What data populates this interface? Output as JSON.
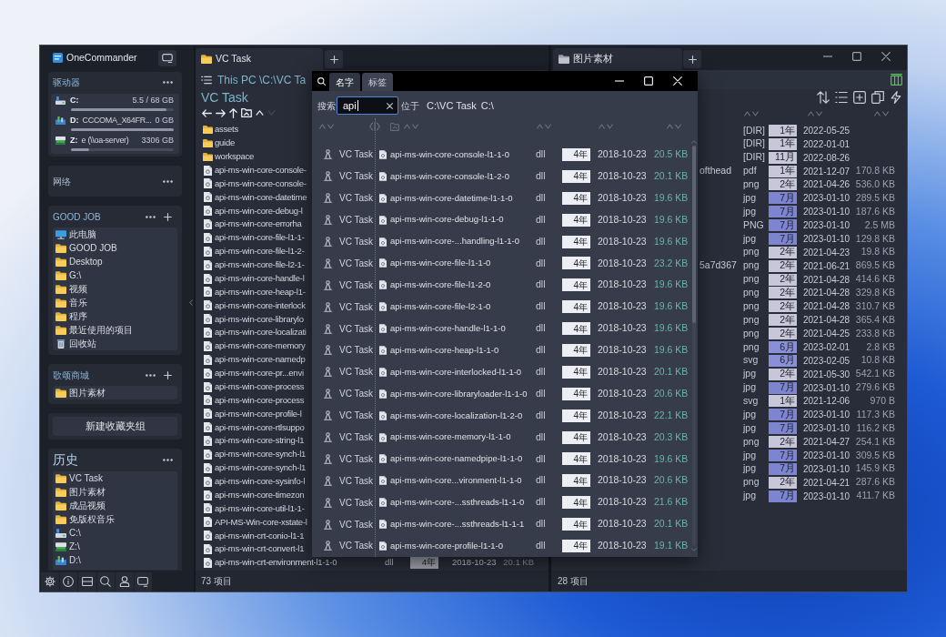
{
  "sidebar": {
    "app_name": "OneCommander",
    "drives": {
      "title": "驱动器",
      "items": [
        {
          "kind": "disk",
          "letter": "C:",
          "free": "5.5 / 68 GB",
          "level": 0.93
        },
        {
          "kind": "removable",
          "letter": "D:",
          "label": "CCCOMA_X64FR...",
          "free": "0 GB",
          "level": 1
        },
        {
          "kind": "network",
          "letter": "Z:",
          "label": "e (\\\\oa-server)",
          "free": "3306 GB",
          "level": 0.18
        }
      ]
    },
    "network": {
      "title": "网络"
    },
    "groups": [
      {
        "title": "GOOD JOB",
        "items": [
          {
            "kind": "computer",
            "name": "此电脑"
          },
          {
            "kind": "folder",
            "name": "GOOD JOB"
          },
          {
            "kind": "folder",
            "name": "Desktop"
          },
          {
            "kind": "folder",
            "name": "G:\\"
          },
          {
            "kind": "folder",
            "name": "视频"
          },
          {
            "kind": "folder",
            "name": "音乐"
          },
          {
            "kind": "folder",
            "name": "程序"
          },
          {
            "kind": "folder",
            "name": "最近使用的项目"
          },
          {
            "kind": "trash",
            "name": "回收站"
          }
        ]
      },
      {
        "title": "歌颂商城",
        "items": [
          {
            "kind": "folder",
            "name": "图片素材"
          }
        ]
      }
    ],
    "new_group_button": "新建收藏夹组",
    "history": {
      "title": "历史",
      "items": [
        {
          "kind": "folder",
          "name": "VC Task"
        },
        {
          "kind": "folder",
          "name": "图片素材"
        },
        {
          "kind": "folder",
          "name": "成品视频"
        },
        {
          "kind": "folder",
          "name": "免版权音乐"
        },
        {
          "kind": "disk",
          "name": "C:\\"
        },
        {
          "kind": "network",
          "name": "Z:\\"
        },
        {
          "kind": "removable",
          "name": "D:\\"
        }
      ]
    }
  },
  "left_pane": {
    "tab": "VC Task",
    "path": "This PC \\C:\\VC Ta",
    "title": "VC Task",
    "nav": [
      {
        "kind": "back",
        "disabled": false
      },
      {
        "kind": "forward",
        "disabled": false
      },
      {
        "kind": "up",
        "disabled": false
      },
      {
        "kind": "parent",
        "disabled": false
      },
      {
        "kind": "chevronup",
        "disabled": false
      },
      {
        "kind": "chevrondown",
        "disabled": true
      }
    ],
    "files": [
      {
        "kind": "folder",
        "name": "assets"
      },
      {
        "kind": "folder",
        "name": "guide"
      },
      {
        "kind": "folder",
        "name": "workspace"
      },
      {
        "kind": "file",
        "name": "api-ms-win-core-console-"
      },
      {
        "kind": "file",
        "name": "api-ms-win-core-console-"
      },
      {
        "kind": "file",
        "name": "api-ms-win-core-datetime"
      },
      {
        "kind": "file",
        "name": "api-ms-win-core-debug-l"
      },
      {
        "kind": "file",
        "name": "api-ms-win-core-errorha"
      },
      {
        "kind": "file",
        "name": "api-ms-win-core-file-l1-1-"
      },
      {
        "kind": "file",
        "name": "api-ms-win-core-file-l1-2-"
      },
      {
        "kind": "file",
        "name": "api-ms-win-core-file-l2-1-"
      },
      {
        "kind": "file",
        "name": "api-ms-win-core-handle-l"
      },
      {
        "kind": "file",
        "name": "api-ms-win-core-heap-l1-"
      },
      {
        "kind": "file",
        "name": "api-ms-win-core-interlock"
      },
      {
        "kind": "file",
        "name": "api-ms-win-core-librarylo"
      },
      {
        "kind": "file",
        "name": "api-ms-win-core-localizati"
      },
      {
        "kind": "file",
        "name": "api-ms-win-core-memory"
      },
      {
        "kind": "file",
        "name": "api-ms-win-core-namedp"
      },
      {
        "kind": "file",
        "name": "api-ms-win-core-pr...envi"
      },
      {
        "kind": "file",
        "name": "api-ms-win-core-process"
      },
      {
        "kind": "file",
        "name": "api-ms-win-core-process"
      },
      {
        "kind": "file",
        "name": "api-ms-win-core-profile-l"
      },
      {
        "kind": "file",
        "name": "api-ms-win-core-rtlsuppo"
      },
      {
        "kind": "file",
        "name": "api-ms-win-core-string-l1"
      },
      {
        "kind": "file",
        "name": "api-ms-win-core-synch-l1"
      },
      {
        "kind": "file",
        "name": "api-ms-win-core-synch-l1"
      },
      {
        "kind": "file",
        "name": "api-ms-win-core-sysinfo-l"
      },
      {
        "kind": "file",
        "name": "api-ms-win-core-timezon"
      },
      {
        "kind": "file",
        "name": "api-ms-win-core-util-l1-1-"
      },
      {
        "kind": "file",
        "name": "API-MS-Win-core-xstate-l"
      },
      {
        "kind": "file",
        "name": "api-ms-win-crt-conio-l1-1"
      },
      {
        "kind": "file",
        "name": "api-ms-win-crt-convert-l1"
      },
      {
        "kind": "file",
        "name": "api-ms-win-crt-environment-l1-1-0",
        "type": "dll",
        "age": "4年",
        "date": "2018-10-23",
        "size": "20.1 KB"
      }
    ],
    "status": "73 项目"
  },
  "right_pane": {
    "tab": "图片素材",
    "files": [
      {
        "type": "[DIR]",
        "age": "1年",
        "color": "#c8c6d9",
        "date": "2022-05-25"
      },
      {
        "type": "[DIR]",
        "age": "1年",
        "color": "#c8c6d9",
        "date": "2022-01-01"
      },
      {
        "type": "[DIR]",
        "age": "11月",
        "color": "#c8c6d9",
        "date": "2022-08-26"
      },
      {
        "name": "ofthead",
        "type": "pdf",
        "age": "1年",
        "color": "#c8c6d9",
        "date": "2021-12-07",
        "size": "170.8 KB"
      },
      {
        "type": "png",
        "age": "2年",
        "color": "#c8c6d9",
        "date": "2021-04-26",
        "size": "536.0 KB"
      },
      {
        "type": "jpg",
        "age": "7月",
        "color": "#7d85d0",
        "date": "2023-01-10",
        "size": "289.5 KB"
      },
      {
        "type": "jpg",
        "age": "7月",
        "color": "#7d85d0",
        "date": "2023-01-10",
        "size": "187.6 KB"
      },
      {
        "type": "PNG",
        "age": "7月",
        "color": "#7d85d0",
        "date": "2023-01-10",
        "size": "2.5 MB"
      },
      {
        "type": "jpg",
        "age": "7月",
        "color": "#7d85d0",
        "date": "2023-01-10",
        "size": "129.8 KB"
      },
      {
        "type": "png",
        "age": "2年",
        "color": "#c8c6d9",
        "date": "2021-04-23",
        "size": "19.8 KB"
      },
      {
        "name": "5a7d367",
        "type": "png",
        "age": "2年",
        "color": "#c8c6d9",
        "date": "2021-06-21",
        "size": "869.5 KB"
      },
      {
        "type": "png",
        "age": "2年",
        "color": "#c8c6d9",
        "date": "2021-04-28",
        "size": "414.6 KB"
      },
      {
        "type": "png",
        "age": "2年",
        "color": "#c8c6d9",
        "date": "2021-04-28",
        "size": "329.8 KB"
      },
      {
        "type": "png",
        "age": "2年",
        "color": "#c8c6d9",
        "date": "2021-04-28",
        "size": "310.7 KB"
      },
      {
        "type": "png",
        "age": "2年",
        "color": "#c8c6d9",
        "date": "2021-04-28",
        "size": "365.4 KB"
      },
      {
        "type": "png",
        "age": "2年",
        "color": "#c8c6d9",
        "date": "2021-04-25",
        "size": "233.8 KB"
      },
      {
        "type": "png",
        "age": "6月",
        "color": "#8a90d8",
        "date": "2023-02-01",
        "size": "2.8 KB"
      },
      {
        "type": "svg",
        "age": "6月",
        "color": "#8a90d8",
        "date": "2023-02-05",
        "size": "10.8 KB"
      },
      {
        "type": "jpg",
        "age": "2年",
        "color": "#c8c6d9",
        "date": "2021-05-30",
        "size": "542.1 KB"
      },
      {
        "type": "jpg",
        "age": "7月",
        "color": "#7d85d0",
        "date": "2023-01-10",
        "size": "279.6 KB"
      },
      {
        "type": "svg",
        "age": "1年",
        "color": "#c8c6d9",
        "date": "2021-12-06",
        "size": "970 B"
      },
      {
        "type": "jpg",
        "age": "7月",
        "color": "#7d85d0",
        "date": "2023-01-10",
        "size": "117.3 KB"
      },
      {
        "type": "jpg",
        "age": "7月",
        "color": "#7d85d0",
        "date": "2023-01-10",
        "size": "116.2 KB"
      },
      {
        "type": "png",
        "age": "2年",
        "color": "#c8c6d9",
        "date": "2021-04-27",
        "size": "254.1 KB"
      },
      {
        "type": "jpg",
        "age": "7月",
        "color": "#7d85d0",
        "date": "2023-01-10",
        "size": "309.5 KB"
      },
      {
        "type": "jpg",
        "age": "7月",
        "color": "#7d85d0",
        "date": "2023-01-10",
        "size": "145.9 KB"
      },
      {
        "type": "png",
        "age": "2年",
        "color": "#c8c6d9",
        "date": "2021-04-21",
        "size": "287.6 KB"
      },
      {
        "type": "jpg",
        "age": "7月",
        "color": "#7d85d0",
        "date": "2023-01-10",
        "size": "411.7 KB"
      }
    ],
    "status": "28 项目"
  },
  "search_dialog": {
    "tabs": [
      {
        "label": "名字",
        "selected": true
      },
      {
        "label": "标签",
        "selected": false
      }
    ],
    "search_label": "搜索",
    "query": "api",
    "location_label": "位于",
    "locations": [
      "C:\\VC Task",
      "C:\\"
    ],
    "results": [
      {
        "location": "VC Task",
        "name": "api-ms-win-core-console-l1-1-0",
        "type": "dll",
        "age": "4年",
        "date": "2018-10-23",
        "size": "20.5 KB"
      },
      {
        "location": "VC Task",
        "name": "api-ms-win-core-console-l1-2-0",
        "type": "dll",
        "age": "4年",
        "date": "2018-10-23",
        "size": "20.1 KB"
      },
      {
        "location": "VC Task",
        "name": "api-ms-win-core-datetime-l1-1-0",
        "type": "dll",
        "age": "4年",
        "date": "2018-10-23",
        "size": "19.6 KB"
      },
      {
        "location": "VC Task",
        "name": "api-ms-win-core-debug-l1-1-0",
        "type": "dll",
        "age": "4年",
        "date": "2018-10-23",
        "size": "19.6 KB"
      },
      {
        "location": "VC Task",
        "name": "api-ms-win-core-...handling-l1-1-0",
        "type": "dll",
        "age": "4年",
        "date": "2018-10-23",
        "size": "19.6 KB"
      },
      {
        "location": "VC Task",
        "name": "api-ms-win-core-file-l1-1-0",
        "type": "dll",
        "age": "4年",
        "date": "2018-10-23",
        "size": "23.2 KB"
      },
      {
        "location": "VC Task",
        "name": "api-ms-win-core-file-l1-2-0",
        "type": "dll",
        "age": "4年",
        "date": "2018-10-23",
        "size": "19.6 KB"
      },
      {
        "location": "VC Task",
        "name": "api-ms-win-core-file-l2-1-0",
        "type": "dll",
        "age": "4年",
        "date": "2018-10-23",
        "size": "19.6 KB"
      },
      {
        "location": "VC Task",
        "name": "api-ms-win-core-handle-l1-1-0",
        "type": "dll",
        "age": "4年",
        "date": "2018-10-23",
        "size": "19.6 KB"
      },
      {
        "location": "VC Task",
        "name": "api-ms-win-core-heap-l1-1-0",
        "type": "dll",
        "age": "4年",
        "date": "2018-10-23",
        "size": "19.6 KB"
      },
      {
        "location": "VC Task",
        "name": "api-ms-win-core-interlocked-l1-1-0",
        "type": "dll",
        "age": "4年",
        "date": "2018-10-23",
        "size": "20.1 KB"
      },
      {
        "location": "VC Task",
        "name": "api-ms-win-core-libraryloader-l1-1-0",
        "type": "dll",
        "age": "4年",
        "date": "2018-10-23",
        "size": "20.6 KB"
      },
      {
        "location": "VC Task",
        "name": "api-ms-win-core-localization-l1-2-0",
        "type": "dll",
        "age": "4年",
        "date": "2018-10-23",
        "size": "22.1 KB"
      },
      {
        "location": "VC Task",
        "name": "api-ms-win-core-memory-l1-1-0",
        "type": "dll",
        "age": "4年",
        "date": "2018-10-23",
        "size": "20.3 KB"
      },
      {
        "location": "VC Task",
        "name": "api-ms-win-core-namedpipe-l1-1-0",
        "type": "dll",
        "age": "4年",
        "date": "2018-10-23",
        "size": "19.6 KB"
      },
      {
        "location": "VC Task",
        "name": "api-ms-win-core...vironment-l1-1-0",
        "type": "dll",
        "age": "4年",
        "date": "2018-10-23",
        "size": "20.6 KB"
      },
      {
        "location": "VC Task",
        "name": "api-ms-win-core-...ssthreads-l1-1-0",
        "type": "dll",
        "age": "4年",
        "date": "2018-10-23",
        "size": "21.6 KB"
      },
      {
        "location": "VC Task",
        "name": "api-ms-win-core-...ssthreads-l1-1-1",
        "type": "dll",
        "age": "4年",
        "date": "2018-10-23",
        "size": "20.1 KB"
      },
      {
        "location": "VC Task",
        "name": "api-ms-win-core-profile-l1-1-0",
        "type": "dll",
        "age": "4年",
        "date": "2018-10-23",
        "size": "19.1 KB"
      }
    ]
  }
}
